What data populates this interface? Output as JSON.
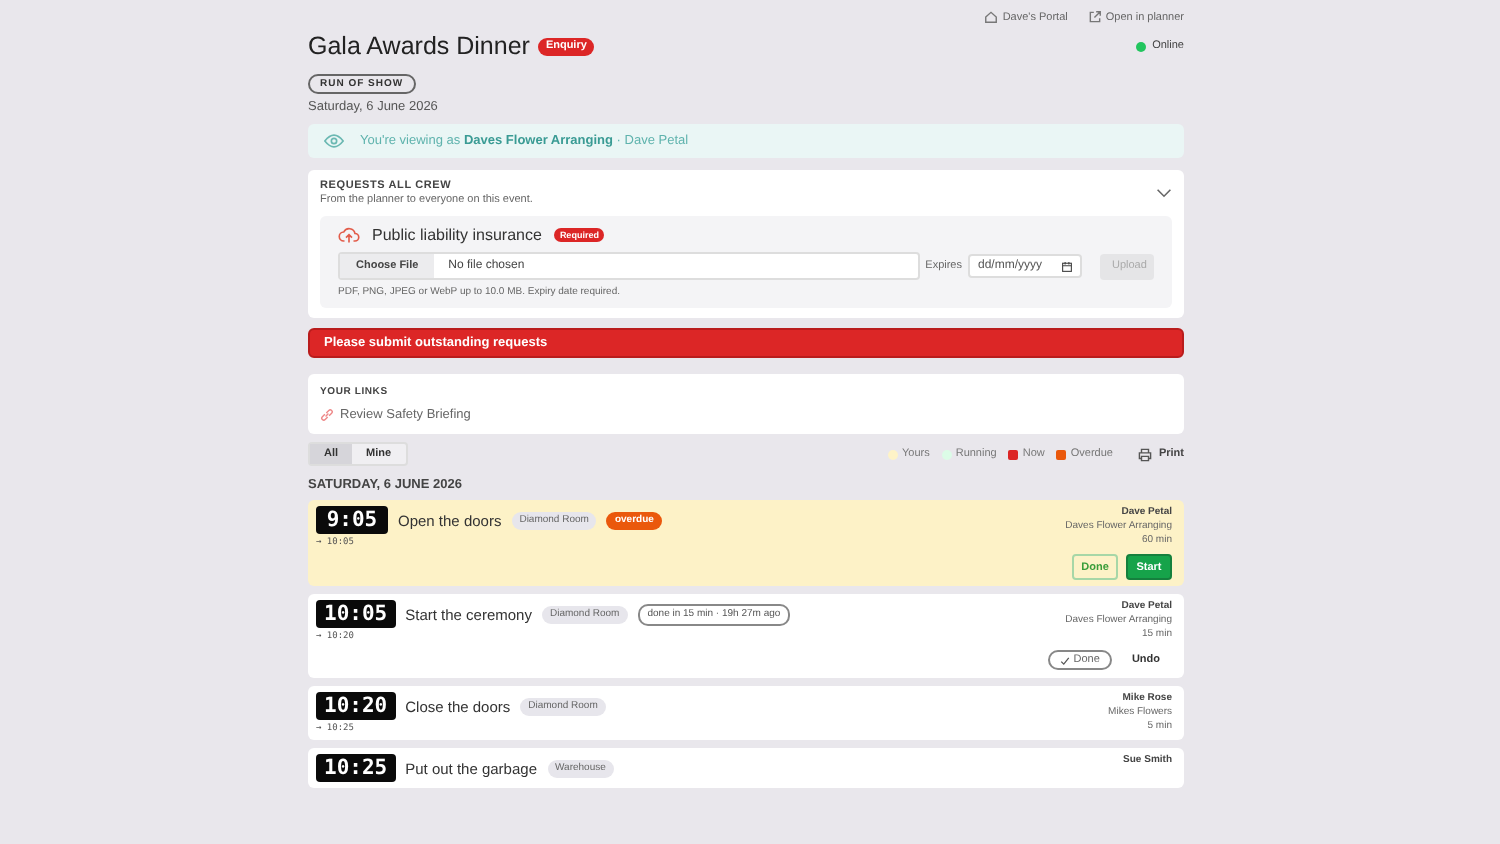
{
  "top_links": [
    {
      "label": "Dave's Portal"
    },
    {
      "label": "Open in planner"
    }
  ],
  "event": {
    "title": "Gala Awards Dinner",
    "badge": "Enquiry",
    "tag": "RUN OF SHOW",
    "date": "Saturday, 6 June 2026"
  },
  "connection": {
    "label": "Online",
    "color": "#22c55e"
  },
  "viewing_banner": {
    "text": "You're viewing as **Daves Flower Arranging** · Dave Petal"
  },
  "requests": {
    "heading": "REQUESTS ALL CREW",
    "subtitle": "From the planner to everyone on this event.",
    "expanded": true,
    "items": [
      {
        "title": "Public liability insurance",
        "badge": "Required",
        "file_button": "Choose File",
        "file_status": "No file chosen",
        "expires_label": "Expires",
        "date_placeholder": "dd/mm/yyyy",
        "upload": "Upload",
        "upload_disabled": true,
        "hint": "PDF, PNG, JPEG or WebP up to 10.0 MB. Expiry date required."
      }
    ]
  },
  "alert": "Please submit outstanding requests",
  "links": {
    "heading": "YOUR LINKS",
    "items": [
      "Review Safety Briefing"
    ]
  },
  "filters": [
    {
      "label": "All",
      "selected": true
    },
    {
      "label": "Mine",
      "selected": false
    }
  ],
  "legend": [
    {
      "label": "Yours",
      "color": "#fef3c7"
    },
    {
      "label": "Running",
      "color": "#dcfce7"
    },
    {
      "label": "Now",
      "color": "#dc2626"
    },
    {
      "label": "Overdue",
      "color": "#ea580c"
    }
  ],
  "print": "Print",
  "day_heading": "SATURDAY, 6 JUNE 2026",
  "cues": [
    {
      "time": "9:05",
      "end": "→ 10:05",
      "title": "Open the doors",
      "location": "Diamond Room",
      "yours": true,
      "status": {
        "kind": "overdue",
        "text": "overdue"
      },
      "owner": "Dave Petal",
      "company": "Daves Flower Arranging",
      "duration": "60 min",
      "actions": [
        {
          "kind": "outline",
          "label": "Done"
        },
        {
          "kind": "primary",
          "label": "Start"
        }
      ]
    },
    {
      "time": "10:05",
      "end": "→ 10:20",
      "title": "Start the ceremony",
      "location": "Diamond Room",
      "yours": false,
      "status": {
        "kind": "done",
        "text": "done in 15 min · 19h 27m ago"
      },
      "owner": "Dave Petal",
      "company": "Daves Flower Arranging",
      "duration": "15 min",
      "actions": [
        {
          "kind": "done",
          "label": "Done"
        },
        {
          "kind": "text",
          "label": "Undo"
        }
      ]
    },
    {
      "time": "10:20",
      "end": "→ 10:25",
      "title": "Close the doors",
      "location": "Diamond Room",
      "yours": false,
      "owner": "Mike Rose",
      "company": "Mikes Flowers",
      "duration": "5 min"
    },
    {
      "time": "10:25",
      "title": "Put out the garbage",
      "location": "Warehouse",
      "yours": false,
      "owner": "Sue Smith"
    }
  ]
}
